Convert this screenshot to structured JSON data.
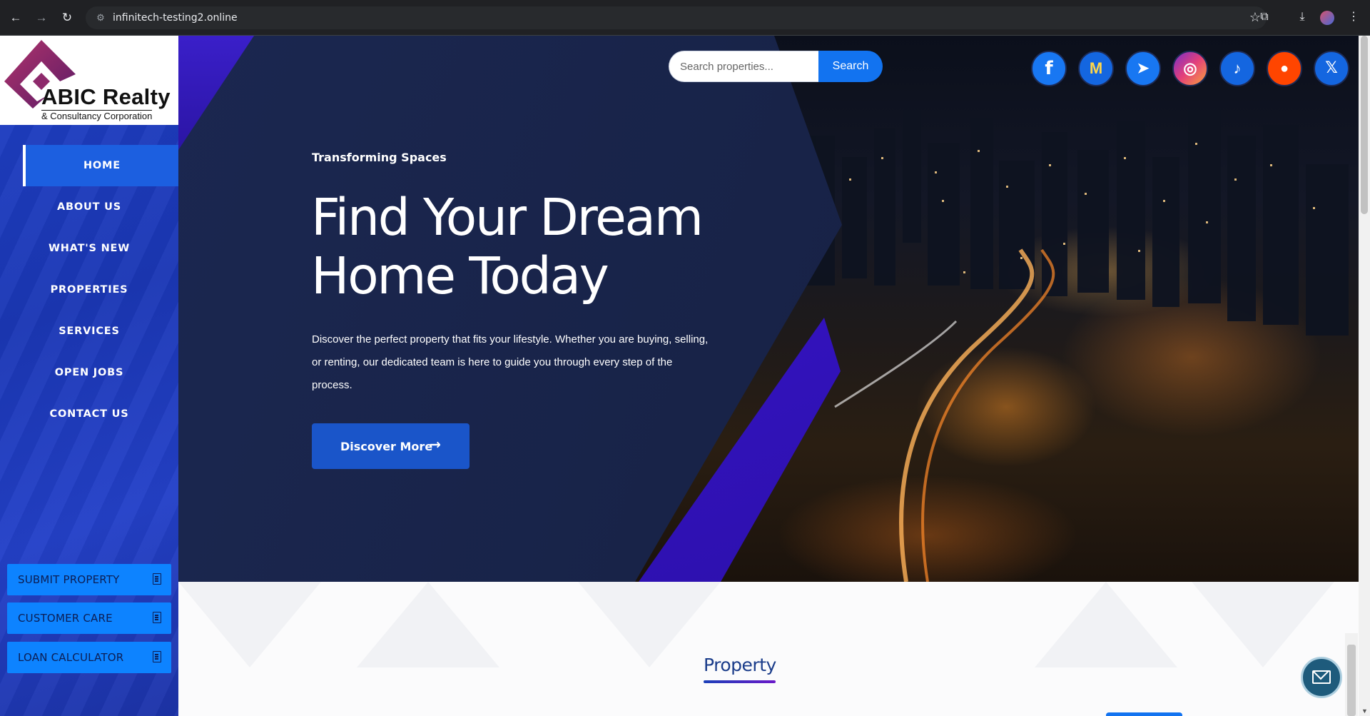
{
  "browser": {
    "url": "infinitech-testing2.online"
  },
  "logo": {
    "name": "ABIC Realty",
    "subtitle": "& Consultancy Corporation"
  },
  "menu": {
    "items": [
      {
        "label": "HOME",
        "active": true
      },
      {
        "label": "ABOUT US"
      },
      {
        "label": "WHAT'S NEW"
      },
      {
        "label": "PROPERTIES"
      },
      {
        "label": "SERVICES"
      },
      {
        "label": "OPEN JOBS"
      },
      {
        "label": "CONTACT US"
      }
    ]
  },
  "quick_actions": [
    {
      "label": "SUBMIT PROPERTY",
      "icon": "document-icon"
    },
    {
      "label": "CUSTOMER CARE",
      "icon": "document-icon"
    },
    {
      "label": "LOAN CALCULATOR",
      "icon": "calculator-icon"
    }
  ],
  "search": {
    "placeholder": "Search properties...",
    "button_label": "Search"
  },
  "social": [
    {
      "name": "facebook-icon",
      "glyph": "f",
      "color": "#1877f2"
    },
    {
      "name": "gmail-icon",
      "glyph": "M",
      "color": "#1877f2"
    },
    {
      "name": "telegram-icon",
      "glyph": "➤",
      "color": "#1877f2"
    },
    {
      "name": "instagram-icon",
      "glyph": "◎",
      "color": "#1877f2"
    },
    {
      "name": "tiktok-icon",
      "glyph": "♪",
      "color": "#1877f2"
    },
    {
      "name": "reddit-icon",
      "glyph": "●",
      "color": "#1877f2"
    },
    {
      "name": "x-icon",
      "glyph": "𝕏",
      "color": "#1877f2"
    }
  ],
  "hero": {
    "subtitle": "Transforming Spaces",
    "title": "Find Your Dream Home Today",
    "description": "Discover the perfect property that fits your lifestyle. Whether you are buying, selling, or renting, our dedicated team is here to guide you through every step of the process.",
    "cta_label": "Discover More"
  },
  "section": {
    "title": "Property"
  },
  "colors": {
    "sidebar": "#1e3fc4",
    "accent": "#1273f0",
    "hero_panel": "#1b2750",
    "purple": "#3b16d6"
  }
}
